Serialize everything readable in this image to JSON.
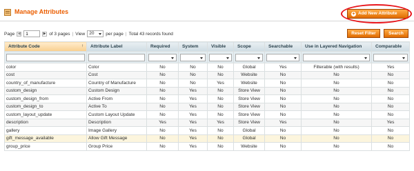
{
  "page": {
    "title": "Manage Attributes"
  },
  "header": {
    "add_button_label": "Add New Attribute"
  },
  "pager": {
    "page_label": "Page",
    "current_page": "1",
    "of_pages": "of 3 pages",
    "view_label": "View",
    "per_page_value": "20",
    "per_page_label": "per page",
    "total": "Total 43 records found"
  },
  "actions": {
    "reset_filter": "Reset Filter",
    "search": "Search"
  },
  "grid": {
    "columns": [
      {
        "label": "Attribute Code",
        "sorted": true
      },
      {
        "label": "Attribute Label"
      },
      {
        "label": "Required"
      },
      {
        "label": "System"
      },
      {
        "label": "Visible"
      },
      {
        "label": "Scope"
      },
      {
        "label": "Searchable"
      },
      {
        "label": "Use in Layered Navigation"
      },
      {
        "label": "Comparable"
      }
    ],
    "sort_indicator": "↑",
    "rows": [
      [
        "color",
        "Color",
        "No",
        "No",
        "No",
        "Global",
        "Yes",
        "Filterable (with results)",
        "Yes"
      ],
      [
        "cost",
        "Cost",
        "No",
        "No",
        "No",
        "Website",
        "No",
        "No",
        "No"
      ],
      [
        "country_of_manufacture",
        "Country of Manufacture",
        "No",
        "No",
        "Yes",
        "Website",
        "No",
        "No",
        "No"
      ],
      [
        "custom_design",
        "Custom Design",
        "No",
        "Yes",
        "No",
        "Store View",
        "No",
        "No",
        "No"
      ],
      [
        "custom_design_from",
        "Active From",
        "No",
        "Yes",
        "No",
        "Store View",
        "No",
        "No",
        "No"
      ],
      [
        "custom_design_to",
        "Active To",
        "No",
        "Yes",
        "No",
        "Store View",
        "No",
        "No",
        "No"
      ],
      [
        "custom_layout_update",
        "Custom Layout Update",
        "No",
        "Yes",
        "No",
        "Store View",
        "No",
        "No",
        "No"
      ],
      [
        "description",
        "Description",
        "Yes",
        "Yes",
        "Yes",
        "Store View",
        "Yes",
        "No",
        "Yes"
      ],
      [
        "gallery",
        "Image Gallery",
        "No",
        "Yes",
        "No",
        "Global",
        "No",
        "No",
        "No"
      ],
      [
        "gift_message_available",
        "Allow Gift Message",
        "No",
        "Yes",
        "No",
        "Global",
        "No",
        "No",
        "No"
      ],
      [
        "group_price",
        "Group Price",
        "No",
        "Yes",
        "No",
        "Website",
        "No",
        "No",
        "No"
      ]
    ],
    "highlight_row_index": 9
  },
  "colors": {
    "accent": "#eb5e00",
    "button": "#e06c00",
    "annotation_ring": "#e8141b"
  }
}
